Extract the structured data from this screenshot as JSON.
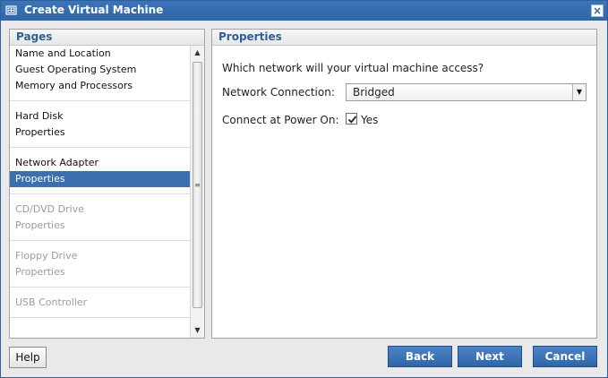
{
  "window": {
    "title": "Create Virtual Machine",
    "close_label": "×"
  },
  "pages_panel": {
    "header": "Pages",
    "groups": [
      {
        "items": [
          {
            "label": "Name and Location",
            "state": "normal"
          },
          {
            "label": "Guest Operating System",
            "state": "normal"
          },
          {
            "label": "Memory and Processors",
            "state": "normal"
          }
        ]
      },
      {
        "items": [
          {
            "label": "Hard Disk",
            "state": "normal"
          },
          {
            "label": "Properties",
            "state": "normal"
          }
        ]
      },
      {
        "items": [
          {
            "label": "Network Adapter",
            "state": "normal"
          },
          {
            "label": "Properties",
            "state": "selected"
          }
        ]
      },
      {
        "items": [
          {
            "label": "CD/DVD Drive",
            "state": "disabled"
          },
          {
            "label": "Properties",
            "state": "disabled"
          }
        ]
      },
      {
        "items": [
          {
            "label": "Floppy Drive",
            "state": "disabled"
          },
          {
            "label": "Properties",
            "state": "disabled"
          }
        ]
      },
      {
        "items": [
          {
            "label": "USB Controller",
            "state": "disabled"
          }
        ]
      }
    ]
  },
  "properties_panel": {
    "header": "Properties",
    "question": "Which network will your virtual machine access?",
    "network_connection_label": "Network Connection:",
    "network_connection_value": "Bridged",
    "connect_power_label": "Connect at Power On:",
    "connect_power_checked": true,
    "connect_power_checkbox_label": "Yes"
  },
  "buttons": {
    "help": "Help",
    "back": "Back",
    "next": "Next",
    "cancel": "Cancel"
  },
  "icons": {
    "title_icon": "virtual-machine-icon",
    "close": "close-icon",
    "scroll_up": "chevron-up-icon",
    "scroll_down": "chevron-down-icon",
    "dropdown": "chevron-down-icon",
    "check": "checkmark-icon"
  },
  "colors": {
    "accent": "#2f66a8",
    "selected_bg": "#3a6fb0",
    "header_text": "#2e5f97",
    "disabled_text": "#9b9b9b"
  }
}
